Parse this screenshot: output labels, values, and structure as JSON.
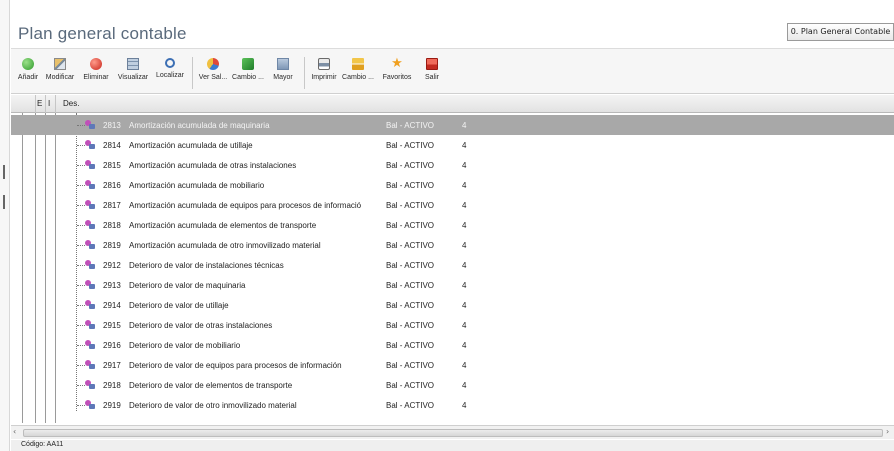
{
  "window": {
    "title": "Plan general contable",
    "plan_selector": "0. Plan General Contable"
  },
  "toolbar": {
    "items": [
      {
        "label": "Añadir",
        "icon": "add-icon"
      },
      {
        "label": "Modificar",
        "icon": "edit-icon"
      },
      {
        "label": "Eliminar",
        "icon": "delete-icon"
      },
      {
        "label": "Visualizar",
        "icon": "view-icon"
      },
      {
        "label": "Localizar",
        "icon": "search-icon"
      },
      {
        "label": "Ver Sal...",
        "icon": "balance-icon"
      },
      {
        "label": "Cambio ...",
        "icon": "change-icon"
      },
      {
        "label": "Mayor",
        "icon": "ledger-icon"
      },
      {
        "label": "Imprimir",
        "icon": "print-icon"
      },
      {
        "label": "Cambio ...",
        "icon": "change-icon"
      },
      {
        "label": "Favoritos",
        "icon": "star-icon"
      },
      {
        "label": "Salir",
        "icon": "exit-icon"
      }
    ]
  },
  "grid": {
    "headers": {
      "col1": "E",
      "col2": "I",
      "desc": "Des."
    },
    "rows": [
      {
        "code": "2813",
        "desc": "Amortización acumulada de maquinaria",
        "type": "Bal - ACTIVO",
        "level": "4",
        "selected": true
      },
      {
        "code": "2814",
        "desc": "Amortización acumulada de utillaje",
        "type": "Bal - ACTIVO",
        "level": "4"
      },
      {
        "code": "2815",
        "desc": "Amortización acumulada de otras instalaciones",
        "type": "Bal - ACTIVO",
        "level": "4"
      },
      {
        "code": "2816",
        "desc": "Amortización acumulada de mobiliario",
        "type": "Bal - ACTIVO",
        "level": "4"
      },
      {
        "code": "2817",
        "desc": "Amortización acumulada de equipos para procesos de informació",
        "type": "Bal - ACTIVO",
        "level": "4"
      },
      {
        "code": "2818",
        "desc": "Amortización acumulada de elementos de transporte",
        "type": "Bal - ACTIVO",
        "level": "4"
      },
      {
        "code": "2819",
        "desc": "Amortización acumulada de otro inmovilizado material",
        "type": "Bal - ACTIVO",
        "level": "4"
      },
      {
        "code": "2912",
        "desc": "Deterioro de valor de instalaciones técnicas",
        "type": "Bal - ACTIVO",
        "level": "4"
      },
      {
        "code": "2913",
        "desc": "Deterioro de valor de maquinaria",
        "type": "Bal - ACTIVO",
        "level": "4"
      },
      {
        "code": "2914",
        "desc": "Deterioro de valor de utillaje",
        "type": "Bal - ACTIVO",
        "level": "4"
      },
      {
        "code": "2915",
        "desc": "Deterioro de valor de otras instalaciones",
        "type": "Bal - ACTIVO",
        "level": "4"
      },
      {
        "code": "2916",
        "desc": "Deterioro de valor de mobiliario",
        "type": "Bal - ACTIVO",
        "level": "4"
      },
      {
        "code": "2917",
        "desc": "Deterioro de valor de equipos para procesos de información",
        "type": "Bal - ACTIVO",
        "level": "4"
      },
      {
        "code": "2918",
        "desc": "Deterioro de valor de elementos de transporte",
        "type": "Bal - ACTIVO",
        "level": "4"
      },
      {
        "code": "2919",
        "desc": "Deterioro de valor de otro inmovilizado material",
        "type": "Bal - ACTIVO",
        "level": "4"
      }
    ]
  },
  "status": {
    "text": "Código: AA11"
  },
  "colors": {
    "selected_row": "#a8a8a8",
    "title": "#5a6a7c"
  }
}
